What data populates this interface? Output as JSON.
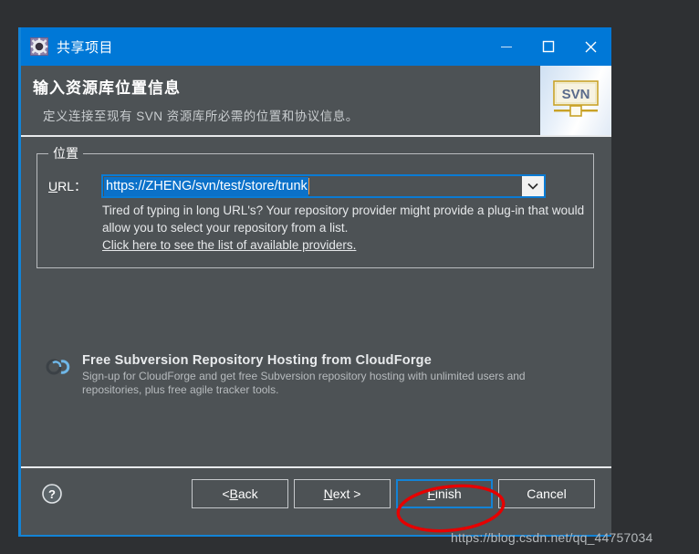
{
  "window": {
    "title": "共享项目",
    "icon": "gear-icon",
    "controls": {
      "minimize": "minimize-icon",
      "maximize": "maximize-icon",
      "close": "close-icon"
    },
    "accent_color": "#0078d7",
    "body_color": "#4d5255"
  },
  "header": {
    "title": "输入资源库位置信息",
    "subtitle": "定义连接至现有 SVN 资源库所必需的位置和协议信息。",
    "logo_text": "SVN"
  },
  "form": {
    "group_label": "位置",
    "url_label_prefix": "U",
    "url_label_rest": "RL：",
    "url_value": "https://ZHENG/svn/test/store/trunk",
    "url_selected": true,
    "dropdown_icon": "chevron-down-icon",
    "hint_text": "Tired of typing in long URL's?  Your repository provider might provide a plug-in that would allow you to select your repository from a list.",
    "hint_link": "Click here to see the list of available providers."
  },
  "promo": {
    "icon": "cloud-icon",
    "title": "Free Subversion Repository Hosting from CloudForge",
    "description": "Sign-up for CloudForge and get free Subversion repository hosting with unlimited users and repositories, plus free agile tracker tools."
  },
  "footer": {
    "help_icon": "help-icon",
    "buttons": [
      {
        "id": "back",
        "prefix": "< ",
        "accel": "B",
        "rest": "ack",
        "focused": false
      },
      {
        "id": "next",
        "prefix": "",
        "accel": "N",
        "rest": "ext >",
        "focused": false
      },
      {
        "id": "finish",
        "prefix": "",
        "accel": "F",
        "rest": "inish",
        "focused": true
      },
      {
        "id": "cancel",
        "prefix": "",
        "accel": "",
        "rest": "Cancel",
        "focused": false
      }
    ]
  },
  "annotation": {
    "shape": "red-ellipse",
    "color": "#e60000",
    "target": "finish-button"
  },
  "watermark": {
    "text": "https://blog.csdn.net/qq_44757034"
  }
}
